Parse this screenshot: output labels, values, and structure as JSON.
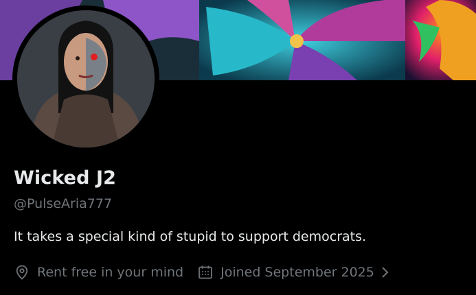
{
  "profile": {
    "display_name": "Wicked J2",
    "handle": "@PulseAria777",
    "bio": "It takes a special kind of stupid to support democrats.",
    "location": "Rent free in your mind",
    "joined": "Joined September 2025"
  },
  "icons": {
    "location": "map-pin-icon",
    "calendar": "calendar-icon",
    "chevron": "chevron-right-icon"
  },
  "colors": {
    "background": "#000000",
    "primary_text": "#e7e9ea",
    "secondary_text": "#71767b"
  }
}
